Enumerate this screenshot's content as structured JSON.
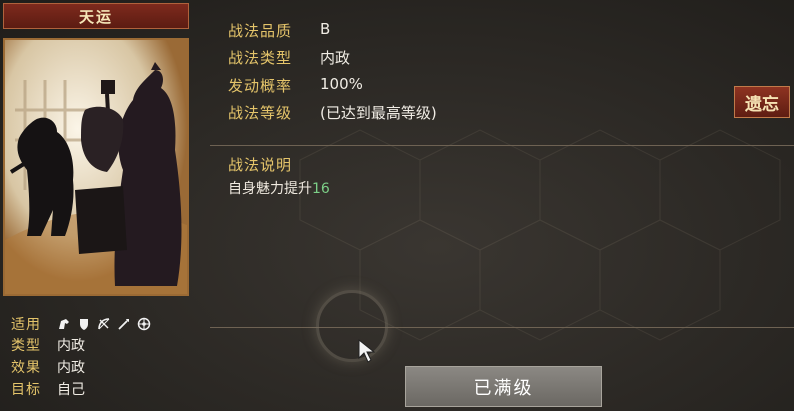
{
  "skill": {
    "name": "天运"
  },
  "attributes": {
    "applicable_label": "适用",
    "unit_icons": [
      "cavalry-icon",
      "shield-icon",
      "bow-icon",
      "spear-icon",
      "siege-icon"
    ],
    "type_label": "类型",
    "type_value": "内政",
    "effect_label": "效果",
    "effect_value": "内政",
    "target_label": "目标",
    "target_value": "自己"
  },
  "details": {
    "quality_label": "战法品质",
    "quality_value": "B",
    "type_label": "战法类型",
    "type_value": "内政",
    "rate_label": "发动概率",
    "rate_value": "100%",
    "level_label": "战法等级",
    "level_value": "(已达到最高等级)"
  },
  "forget_button": "遗忘",
  "description": {
    "title": "战法说明",
    "text": "自身魅力提升",
    "number": "16"
  },
  "max_button": "已满级",
  "colors": {
    "gold_label": "#e4c46a",
    "green_number": "#7ccf87",
    "red_button": "#8e3321"
  }
}
